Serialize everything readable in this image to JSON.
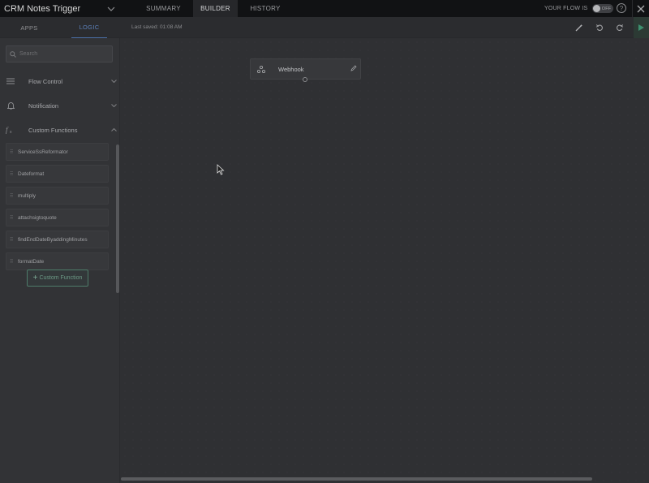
{
  "topbar": {
    "app_title": "CRM Notes Trigger",
    "tabs": [
      {
        "label": "SUMMARY",
        "active": false
      },
      {
        "label": "BUILDER",
        "active": true
      },
      {
        "label": "HISTORY",
        "active": false
      }
    ],
    "flow_status_label": "YOUR FLOW IS",
    "toggle_label": "OFF",
    "help_label": "?"
  },
  "subheader": {
    "left_tabs": [
      {
        "label": "APPS",
        "active": false
      },
      {
        "label": "LOGIC",
        "active": true
      }
    ],
    "last_saved": "Last saved: 01:08 AM",
    "toolbar_icons": [
      "magic-wand-icon",
      "undo-icon",
      "redo-icon",
      "play-icon"
    ]
  },
  "left_panel": {
    "search_placeholder": "Search",
    "sections": [
      {
        "label": "Flow Control",
        "icon": "list-icon",
        "expanded": false
      },
      {
        "label": "Notification",
        "icon": "bell-icon",
        "expanded": false
      },
      {
        "label": "Custom Functions",
        "icon": "function-icon",
        "expanded": true
      }
    ],
    "custom_functions": [
      "ServiceSsReformator",
      "Dateformat",
      "multiply",
      "attachsigtoquote",
      "findEndDateByaddingMinutes",
      "formatDate"
    ],
    "custom_function_button": "Custom Function"
  },
  "canvas": {
    "node": {
      "title": "Webhook",
      "icon": "webhook-icon"
    }
  },
  "colors": {
    "accent_blue": "#4b6fa8",
    "accent_green": "#4e7c6a",
    "background": "#2f3033"
  }
}
